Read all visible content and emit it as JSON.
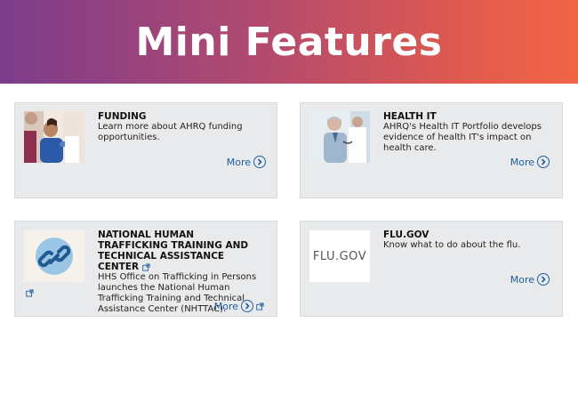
{
  "banner": {
    "title": "Mini Features"
  },
  "cards": [
    {
      "title": "FUNDING",
      "description": "Learn more about AHRQ funding opportunities.",
      "more": "More"
    },
    {
      "title": "HEALTH IT",
      "description": "AHRQ's Health IT Portfolio develops evidence of health IT's impact on health care.",
      "more": "More"
    },
    {
      "title": "NATIONAL HUMAN TRAFFICKING TRAINING AND TECHNICAL ASSISTANCE CENTER",
      "description": "HHS Office on Trafficking in Persons launches the National Human Trafficking Training and Technical Assistance Center (NHTTAC).",
      "more": "More"
    },
    {
      "title": "FLU.GOV",
      "description": "Know what to do about the flu.",
      "more": "More",
      "logo_text": "FLU.GOV"
    }
  ],
  "icons": {
    "more": "chevron-right-circle-icon",
    "external": "external-link-icon",
    "link": "link-icon"
  },
  "colors": {
    "banner_start": "#7d3c8c",
    "banner_end": "#f26545",
    "card_bg": "#e9eaec",
    "link": "#1f5fa0"
  }
}
